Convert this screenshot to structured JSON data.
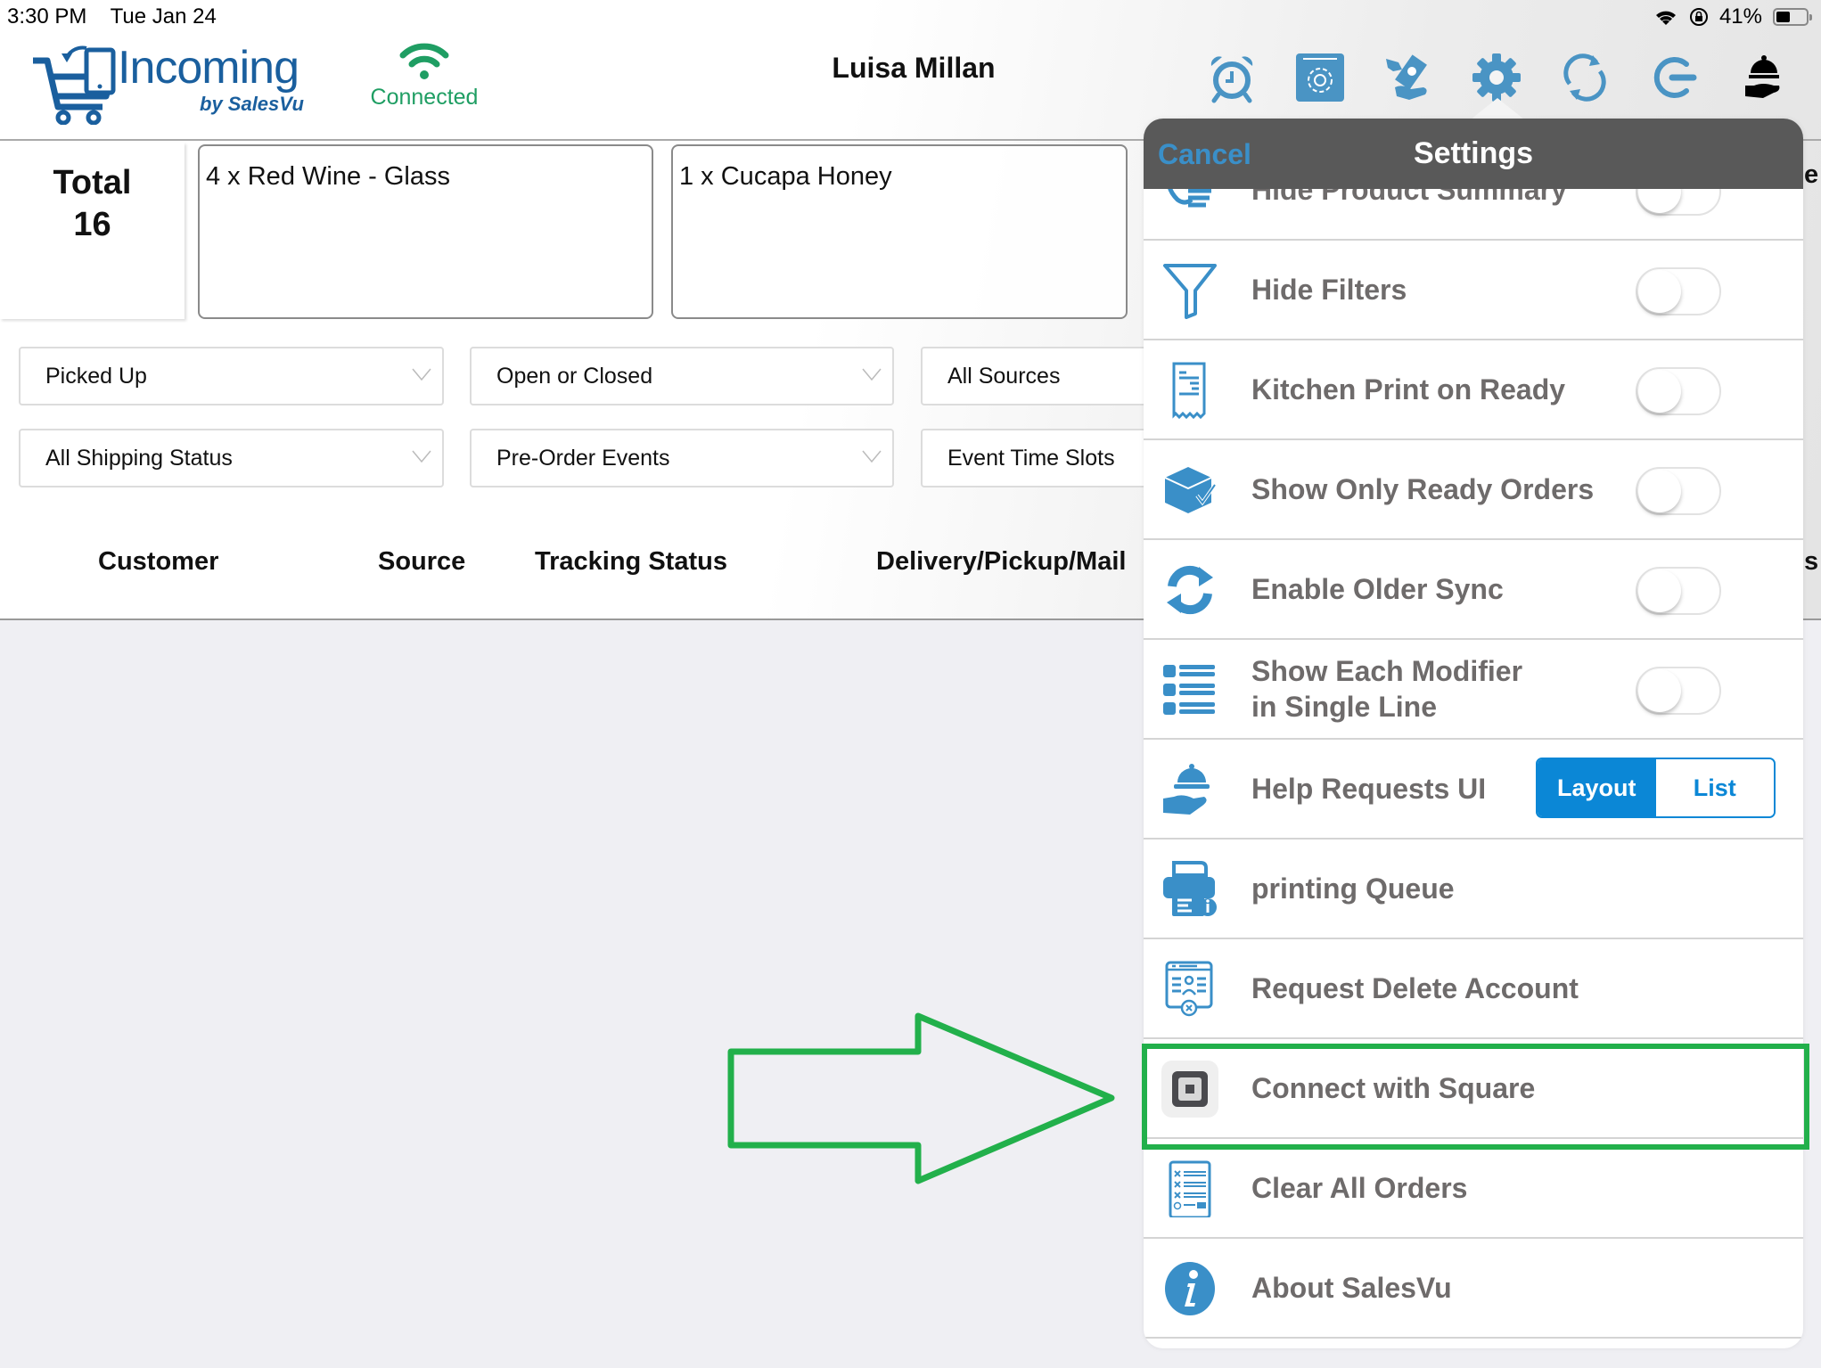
{
  "status_bar": {
    "time": "3:30 PM",
    "date": "Tue Jan 24",
    "battery": "41%",
    "battery_level": 0.41,
    "icons": [
      "wifi-icon",
      "rotation-lock-icon",
      "battery-icon"
    ]
  },
  "header": {
    "app_title": "Incoming",
    "app_subtitle": "by SalesVu",
    "connection_status": "Connected",
    "user_name": "Luisa Millan",
    "toolbar_icons": [
      "alarm-clock-icon",
      "settings-box-icon",
      "cash-payment-icon",
      "gear-icon",
      "sync-icon",
      "logout-icon",
      "help-request-bell-icon"
    ],
    "brand_color": "#1a5f9e",
    "icon_color": "#4a94c4",
    "connected_color": "#1f9e63"
  },
  "summary": {
    "total_label": "Total",
    "total_value": "16",
    "product_cards": [
      {
        "text": "4 x Red Wine - Glass"
      },
      {
        "text": "1 x Cucapa Honey"
      }
    ]
  },
  "filters": {
    "row1": [
      "Picked Up",
      "Open or Closed",
      "All Sources"
    ],
    "row2": [
      "All Shipping Status",
      "Pre-Order Events",
      "Event Time Slots"
    ]
  },
  "table": {
    "columns": [
      "Customer",
      "Source",
      "Tracking Status",
      "Delivery/Pickup/Mail"
    ],
    "partially_hidden_right": [
      "e",
      "s"
    ]
  },
  "settings_popover": {
    "title": "Settings",
    "cancel_label": "Cancel",
    "items": [
      {
        "label": "Hide Product Summary",
        "icon": "hand-list-icon",
        "control": "toggle",
        "on": false
      },
      {
        "label": "Hide Filters",
        "icon": "filter-icon",
        "control": "toggle",
        "on": false
      },
      {
        "label": "Kitchen Print on Ready",
        "icon": "receipt-icon",
        "control": "toggle",
        "on": false
      },
      {
        "label": "Show Only Ready Orders",
        "icon": "box-check-icon",
        "control": "toggle",
        "on": false
      },
      {
        "label": "Enable Older Sync",
        "icon": "sync-icon",
        "control": "toggle",
        "on": false
      },
      {
        "label": "Show Each Modifier\nin Single Line",
        "icon": "list-icon",
        "control": "toggle",
        "on": false
      },
      {
        "label": "Help Requests UI",
        "icon": "help-request-bell-icon",
        "control": "segmented",
        "options": [
          "Layout",
          "List"
        ],
        "selected": "Layout"
      },
      {
        "label": "printing Queue",
        "icon": "printer-info-icon",
        "control": "none"
      },
      {
        "label": "Request Delete Account",
        "icon": "delete-account-icon",
        "control": "none"
      },
      {
        "label": "Connect with Square",
        "icon": "square-logo-icon",
        "control": "none",
        "highlighted": true
      },
      {
        "label": "Clear All Orders",
        "icon": "clear-list-icon",
        "control": "none"
      },
      {
        "label": "About SalesVu",
        "icon": "info-icon",
        "control": "none"
      }
    ],
    "header_color": "#595959",
    "accent_color": "#0b87d6"
  },
  "annotation": {
    "arrow_color": "#22b04b",
    "highlight_target": "Connect with Square"
  }
}
